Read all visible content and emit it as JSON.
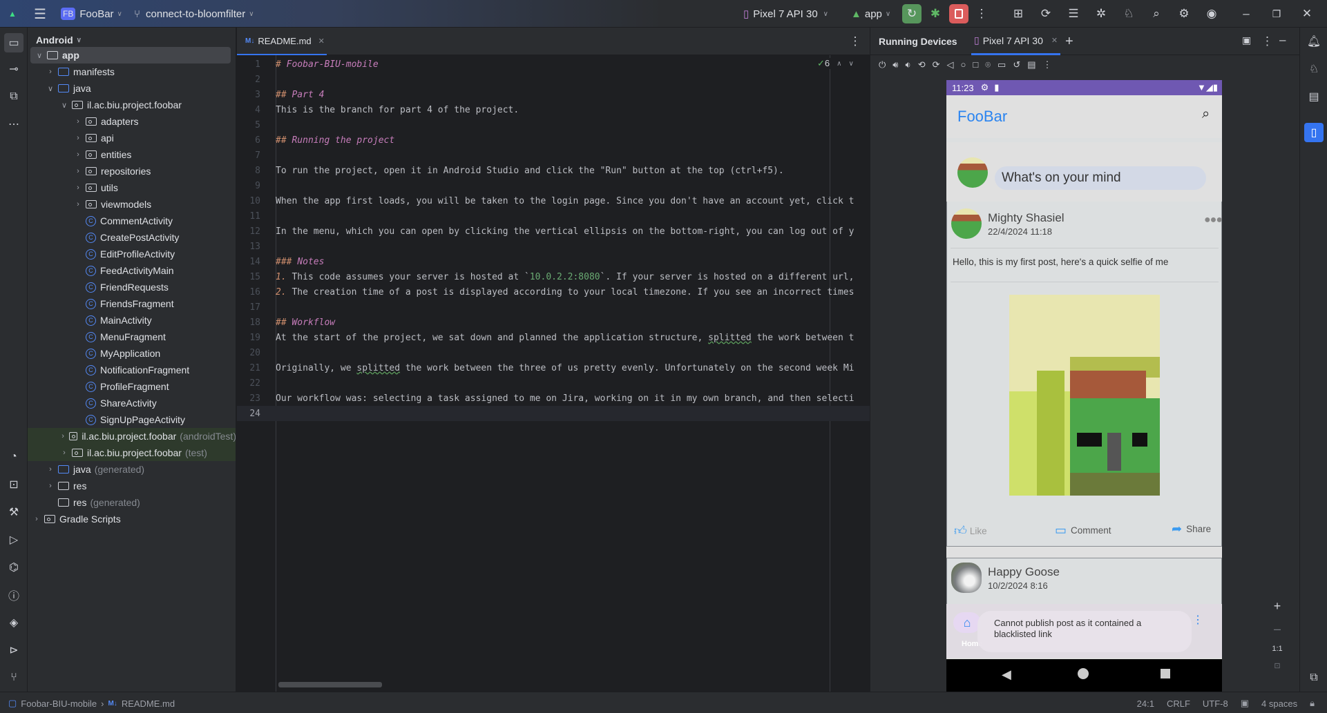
{
  "titlebar": {
    "project_badge": "FB",
    "project": "FooBar",
    "branch": "connect-to-bloomfilter",
    "device": "Pixel 7 API 30",
    "run_config": "app"
  },
  "project_panel": {
    "view": "Android",
    "tree": [
      {
        "label": "app",
        "depth": 0,
        "kind": "module",
        "open": true
      },
      {
        "label": "manifests",
        "depth": 1,
        "kind": "folder",
        "closed": true
      },
      {
        "label": "java",
        "depth": 1,
        "kind": "folder",
        "open": true
      },
      {
        "label": "il.ac.biu.project.foobar",
        "depth": 2,
        "kind": "pkg",
        "open": true
      },
      {
        "label": "adapters",
        "depth": 3,
        "kind": "pkg",
        "closed": true
      },
      {
        "label": "api",
        "depth": 3,
        "kind": "pkg",
        "closed": true
      },
      {
        "label": "entities",
        "depth": 3,
        "kind": "pkg",
        "closed": true
      },
      {
        "label": "repositories",
        "depth": 3,
        "kind": "pkg",
        "closed": true
      },
      {
        "label": "utils",
        "depth": 3,
        "kind": "pkg",
        "closed": true
      },
      {
        "label": "viewmodels",
        "depth": 3,
        "kind": "pkg",
        "closed": true
      },
      {
        "label": "CommentActivity",
        "depth": 3,
        "kind": "class"
      },
      {
        "label": "CreatePostActivity",
        "depth": 3,
        "kind": "class"
      },
      {
        "label": "EditProfileActivity",
        "depth": 3,
        "kind": "class"
      },
      {
        "label": "FeedActivityMain",
        "depth": 3,
        "kind": "class"
      },
      {
        "label": "FriendRequests",
        "depth": 3,
        "kind": "class"
      },
      {
        "label": "FriendsFragment",
        "depth": 3,
        "kind": "class"
      },
      {
        "label": "MainActivity",
        "depth": 3,
        "kind": "class"
      },
      {
        "label": "MenuFragment",
        "depth": 3,
        "kind": "class"
      },
      {
        "label": "MyApplication",
        "depth": 3,
        "kind": "class"
      },
      {
        "label": "NotificationFragment",
        "depth": 3,
        "kind": "class"
      },
      {
        "label": "ProfileFragment",
        "depth": 3,
        "kind": "class"
      },
      {
        "label": "ShareActivity",
        "depth": 3,
        "kind": "class"
      },
      {
        "label": "SignUpPageActivity",
        "depth": 3,
        "kind": "class"
      },
      {
        "label": "il.ac.biu.project.foobar",
        "suffix": "(androidTest)",
        "depth": 2,
        "kind": "pkg",
        "closed": true,
        "test": true
      },
      {
        "label": "il.ac.biu.project.foobar",
        "suffix": "(test)",
        "depth": 2,
        "kind": "pkg",
        "closed": true,
        "test": true
      },
      {
        "label": "java",
        "suffix": "(generated)",
        "depth": 1,
        "kind": "folder",
        "closed": true
      },
      {
        "label": "res",
        "depth": 1,
        "kind": "res",
        "closed": true
      },
      {
        "label": "res",
        "suffix": "(generated)",
        "depth": 1,
        "kind": "res"
      },
      {
        "label": "Gradle Scripts",
        "depth": 0,
        "kind": "gradle",
        "closed": true
      }
    ]
  },
  "editor": {
    "tab": "README.md",
    "tab_badge": "M↓",
    "inspections": "6",
    "lines": [
      [
        [
          "hash",
          "# "
        ],
        [
          "hd",
          "Foobar-BIU-mobile"
        ]
      ],
      [],
      [
        [
          "hash",
          "## "
        ],
        [
          "hd",
          "Part 4"
        ]
      ],
      [
        [
          "t",
          "This is the branch for part 4 of the project."
        ]
      ],
      [],
      [
        [
          "hash",
          "## "
        ],
        [
          "hd",
          "Running the project"
        ]
      ],
      [],
      [
        [
          "t",
          "To run the project, open it in Android Studio and click the \"Run\" button at the top (ctrl+f5)."
        ]
      ],
      [],
      [
        [
          "t",
          "When the app first loads, you will be taken to the login page. Since you don't have an account yet, click t"
        ]
      ],
      [],
      [
        [
          "t",
          "In the menu, which you can open by clicking the vertical ellipsis on the bottom-right, you can log out of y"
        ]
      ],
      [],
      [
        [
          "hash",
          "### "
        ],
        [
          "hd",
          "Notes"
        ]
      ],
      [
        [
          "hash",
          "1. "
        ],
        [
          "t",
          "This code assumes your server is hosted at `"
        ],
        [
          "cs",
          "10.0.2.2:8080"
        ],
        [
          "t",
          "`. If your server is hosted on a different url,"
        ]
      ],
      [
        [
          "hash",
          "2. "
        ],
        [
          "t",
          "The creation time of a post is displayed according to your local timezone. If you see an incorrect times"
        ]
      ],
      [],
      [
        [
          "hash",
          "## "
        ],
        [
          "hd",
          "Workflow"
        ]
      ],
      [
        [
          "t",
          "At the start of the project, we sat down and planned the application structure, "
        ],
        [
          "sq",
          "splitted"
        ],
        [
          "t",
          " the work between t"
        ]
      ],
      [],
      [
        [
          "t",
          "Originally, we "
        ],
        [
          "sq",
          "splitted"
        ],
        [
          "t",
          " the work between the three of us pretty evenly. Unfortunately on the second week Mi"
        ]
      ],
      [],
      [
        [
          "t",
          "Our workflow was: selecting a task assigned to me on Jira, working on it in my own branch, and then selecti"
        ]
      ],
      []
    ]
  },
  "devices": {
    "title": "Running Devices",
    "tab": "Pixel 7 API 30",
    "zoom_label": "1:1"
  },
  "phone": {
    "time": "11:23",
    "app_title": "FooBar",
    "composer_placeholder": "What's on your mind",
    "post1": {
      "author": "Mighty Shasiel",
      "date": "22/4/2024 11:18",
      "text": "Hello, this is my first post, here's a quick selfie of me",
      "like": "Like",
      "comment": "Comment",
      "share": "Share"
    },
    "post2": {
      "author": "Happy Goose",
      "date": "10/2/2024 8:16"
    },
    "nav_home": "Home",
    "toast": "Cannot publish post as it contained a blacklisted link"
  },
  "statusbar": {
    "project": "Foobar-BIU-mobile",
    "file": "README.md",
    "position": "24:1",
    "line_sep": "CRLF",
    "encoding": "UTF-8",
    "indent": "4 spaces"
  }
}
